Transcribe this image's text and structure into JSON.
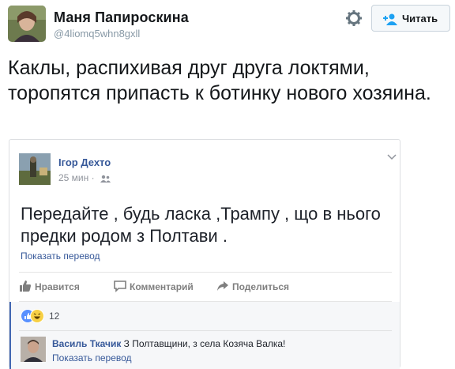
{
  "tweet": {
    "name": "Маня Папироскина",
    "handle": "@4liomq5whn8gxll",
    "follow_label": "Читать",
    "text": "Каклы, распихивая друг друга локтями, торопятся припасть к ботинку нового хозяина."
  },
  "fb_post": {
    "author": "Ігор Дехто",
    "time": "25 мин",
    "separator": "·",
    "text": "Передайте , будь ласка ,Трампу , що в нього предки родом з Полтави .",
    "translate": "Показать перевод",
    "actions": {
      "like": "Нравится",
      "comment": "Комментарий",
      "share": "Поделиться"
    },
    "reaction_count": "12",
    "comment": {
      "author": "Василь Ткачик",
      "text": "З Полтавщини, з села Козяча Валка!",
      "translate": "Показать перевод"
    }
  },
  "icons": [
    "gear-icon",
    "follow-person-icon",
    "chevron-down-icon",
    "friends-icon",
    "like-icon",
    "comment-icon",
    "share-icon",
    "like-reaction-icon",
    "haha-reaction-icon"
  ],
  "colors": {
    "fb_link": "#365899",
    "fb_accent": "#4267b2",
    "tw_text": "#14171a",
    "tw_muted": "#8899a6"
  }
}
